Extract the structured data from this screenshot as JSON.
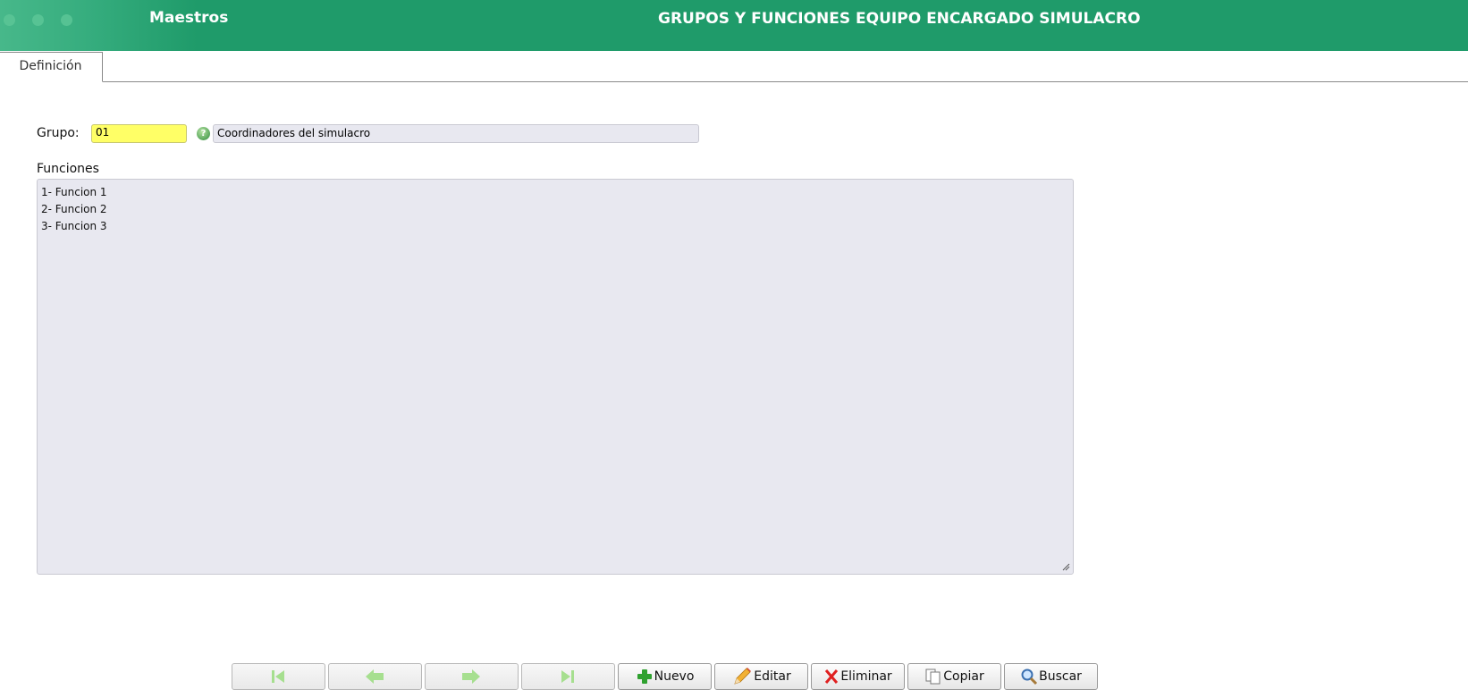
{
  "header": {
    "module": "Maestros",
    "title": "GRUPOS Y FUNCIONES EQUIPO ENCARGADO SIMULACRO",
    "color": "#1f9b6a"
  },
  "tabs": [
    {
      "label": "Definición",
      "active": true
    }
  ],
  "form": {
    "grupo_label": "Grupo:",
    "grupo_code": "01",
    "grupo_code_color": "#ffff66",
    "grupo_help_icon": "help-icon",
    "grupo_description": "Coordinadores del simulacro",
    "funciones_label": "Funciones",
    "funciones_lines": [
      "1- Funcion 1",
      "2- Funcion 2",
      "3- Funcion 3"
    ]
  },
  "toolbar": {
    "first": {
      "icon": "first-record-icon",
      "label": "",
      "enabled": false
    },
    "prev": {
      "icon": "previous-record-icon",
      "label": "",
      "enabled": false
    },
    "next": {
      "icon": "next-record-icon",
      "label": "",
      "enabled": false
    },
    "last": {
      "icon": "last-record-icon",
      "label": "",
      "enabled": false
    },
    "nuevo": {
      "icon": "plus-icon",
      "label": "Nuevo"
    },
    "editar": {
      "icon": "pencil-icon",
      "label": "Editar"
    },
    "eliminar": {
      "icon": "x-icon",
      "label": "Eliminar"
    },
    "copiar": {
      "icon": "copy-icon",
      "label": "Copiar"
    },
    "buscar": {
      "icon": "magnifier-icon",
      "label": "Buscar"
    }
  }
}
